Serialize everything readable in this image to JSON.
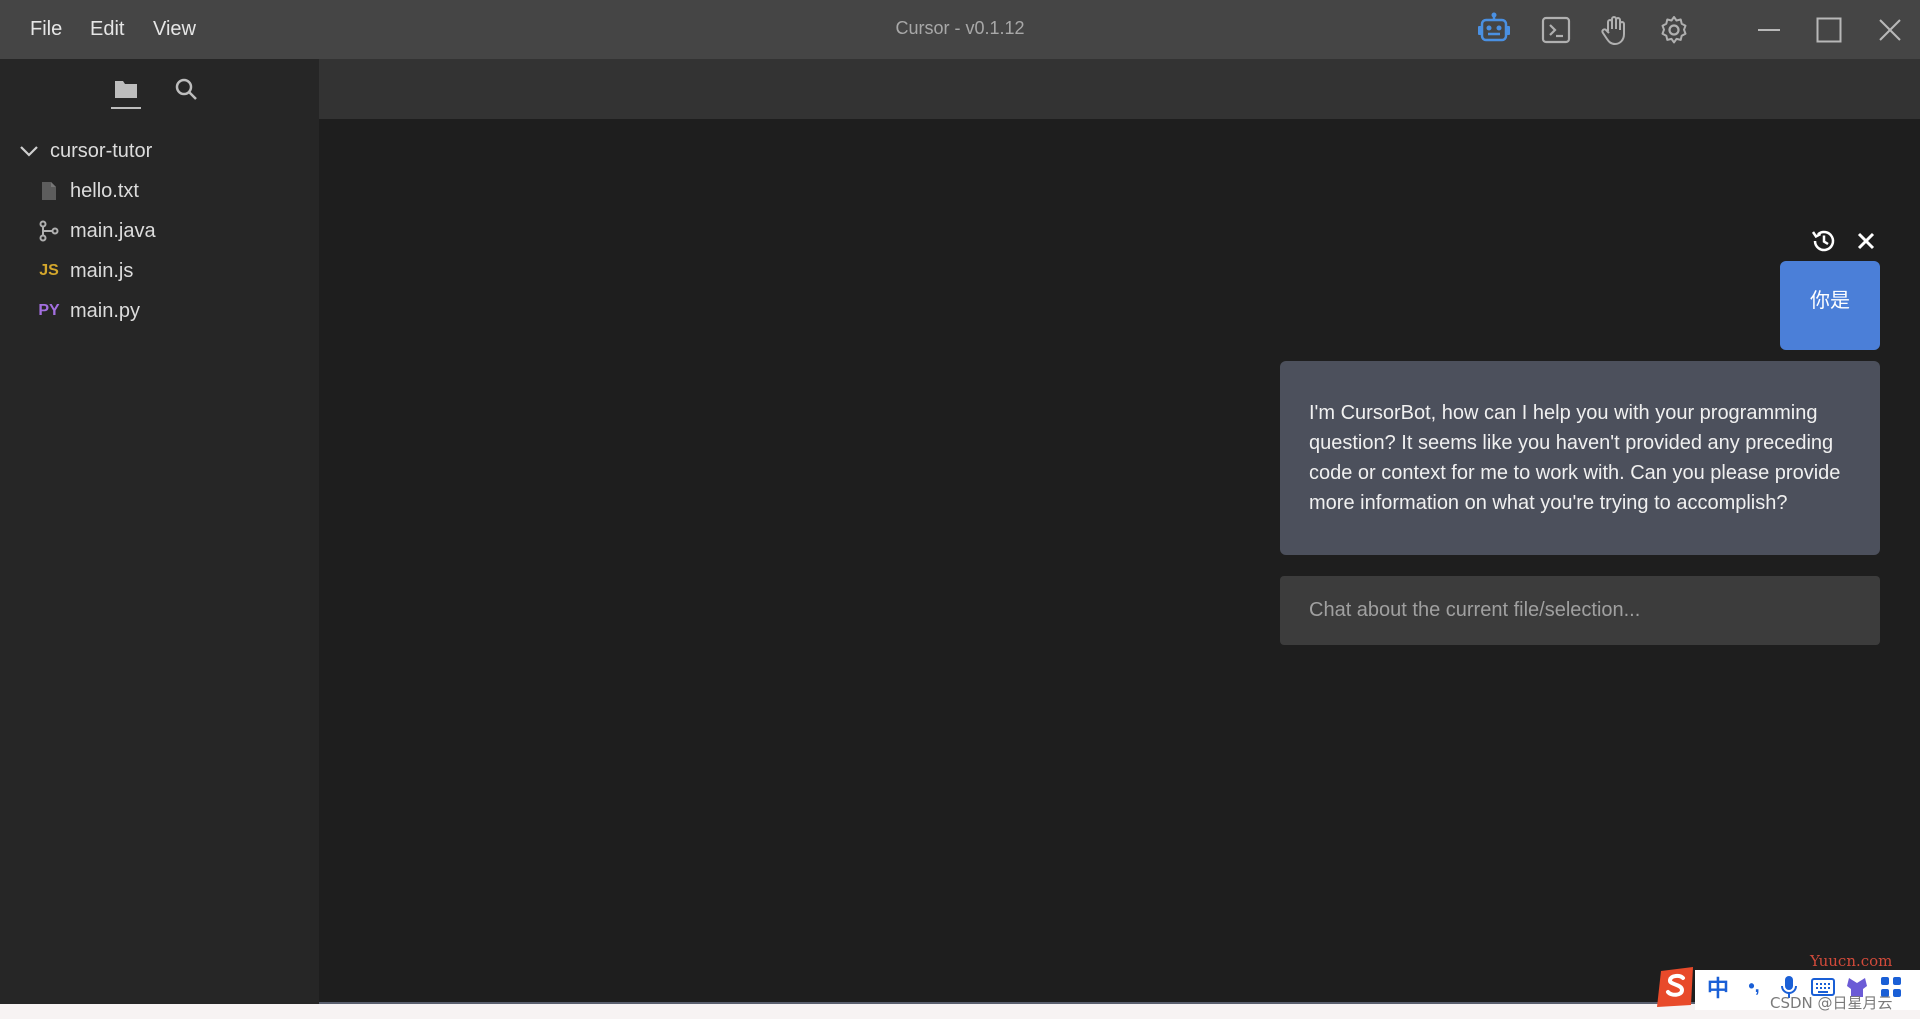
{
  "menu": {
    "items": [
      "File",
      "Edit",
      "View"
    ]
  },
  "window": {
    "title": "Cursor - v0.1.12"
  },
  "toolbar_icons": [
    "robot-icon",
    "terminal-icon",
    "hand-icon",
    "gear-icon"
  ],
  "window_controls": [
    "minimize-icon",
    "maximize-icon",
    "close-icon"
  ],
  "sidebar": {
    "tabs": [
      "folder-icon",
      "search-icon"
    ],
    "root": "cursor-tutor",
    "files": [
      {
        "name": "hello.txt",
        "icon": "file-icon"
      },
      {
        "name": "main.java",
        "icon": "git-branch-icon"
      },
      {
        "name": "main.js",
        "icon": "js-icon",
        "badge": "JS"
      },
      {
        "name": "main.py",
        "icon": "python-icon",
        "badge": "PY"
      }
    ]
  },
  "chat": {
    "controls": [
      "history-icon",
      "close-icon"
    ],
    "user_message": "你是",
    "bot_message": "I'm CursorBot, how can I help you with your programming question? It seems like you haven't provided any preceding code or context for me to work with. Can you please provide more information on what you're trying to accomplish?",
    "input_placeholder": "Chat about the current file/selection..."
  },
  "ime": {
    "lang": "中",
    "punct": "•,"
  },
  "watermarks": {
    "site": "Yuucn.com",
    "csdn": "CSDN @日星月云"
  },
  "colors": {
    "titlebar": "#454545",
    "sidebar": "#262626",
    "editor": "#1e1e1e",
    "tabbar": "#333333",
    "user_bubble": "#4b7fd8",
    "bot_bubble": "#4c505c",
    "chat_input": "#3c3c3c",
    "robot_accent": "#4a90e2"
  }
}
